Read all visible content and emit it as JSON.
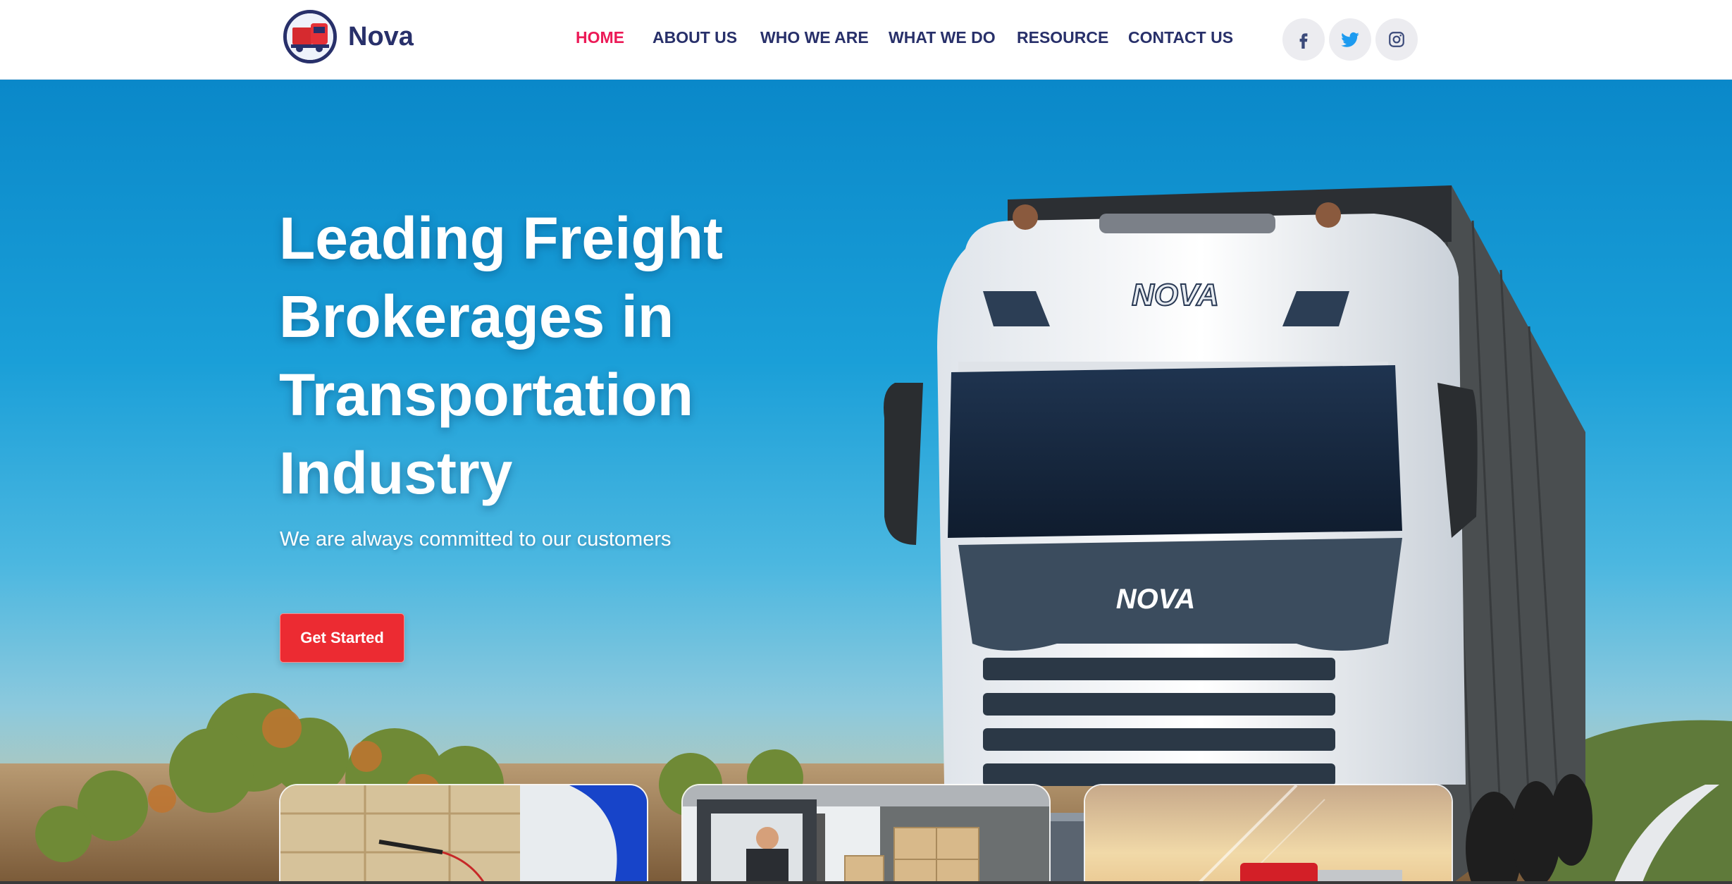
{
  "brand": {
    "name": "Nova",
    "logo_icon": "truck-logo-icon"
  },
  "nav": {
    "items": [
      {
        "label": "HOME",
        "active": true
      },
      {
        "label": "ABOUT US",
        "active": false
      },
      {
        "label": "WHO WE ARE",
        "active": false
      },
      {
        "label": "WHAT WE DO",
        "active": false
      },
      {
        "label": "RESOURCE",
        "active": false
      },
      {
        "label": "CONTACT US",
        "active": false
      }
    ]
  },
  "social": [
    {
      "icon": "facebook-icon"
    },
    {
      "icon": "twitter-icon"
    },
    {
      "icon": "instagram-icon"
    }
  ],
  "hero": {
    "title_lines": [
      "Leading Freight",
      "Brokerages in",
      "Transportation",
      "Industry"
    ],
    "subtitle": "We are always committed to our customers",
    "cta_label": "Get Started",
    "truck_brand": "NOVA"
  },
  "cards": [
    {
      "image": "boxes-scanning-photo"
    },
    {
      "image": "forklift-loading-photo"
    },
    {
      "image": "red-truck-sunset-photo"
    }
  ],
  "colors": {
    "brand_navy": "#28306a",
    "active_pink": "#ec1a57",
    "cta_red": "#ec2b32",
    "social_bg": "#ececf0",
    "facebook": "#3b4a7a",
    "twitter": "#1d9bf0",
    "instagram": "#3b4a7a"
  }
}
